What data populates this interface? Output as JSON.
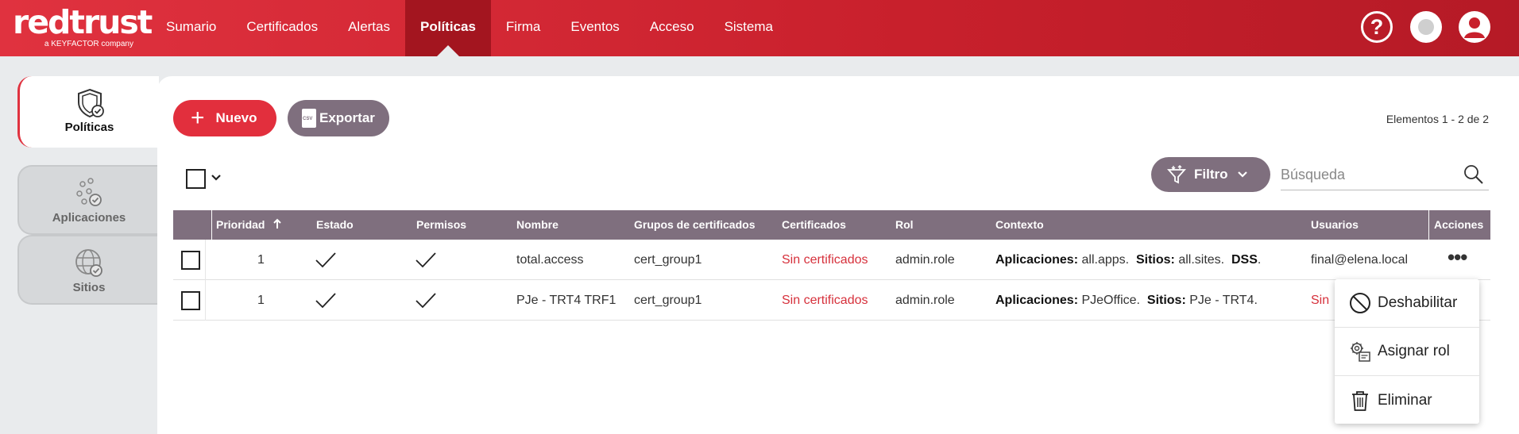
{
  "brand": {
    "name": "redtrust",
    "tagline": "a KEYFACTOR company"
  },
  "nav": {
    "items": [
      "Sumario",
      "Certificados",
      "Alertas",
      "Políticas",
      "Firma",
      "Eventos",
      "Acceso",
      "Sistema"
    ],
    "active": "Políticas",
    "help_icon": "?"
  },
  "sidebar": {
    "items": [
      {
        "label": "Políticas",
        "icon": "shield-check-icon",
        "active": true
      },
      {
        "label": "Aplicaciones",
        "icon": "apps-check-icon",
        "active": false
      },
      {
        "label": "Sitios",
        "icon": "globe-check-icon",
        "active": false
      }
    ]
  },
  "toolbar": {
    "new_label": "Nuevo",
    "export_label": "Exportar",
    "export_badge": "CSV",
    "elements_count": "Elementos 1 - 2 de 2",
    "filter_label": "Filtro",
    "search_placeholder": "Búsqueda"
  },
  "table": {
    "columns": [
      "Prioridad",
      "Estado",
      "Permisos",
      "Nombre",
      "Grupos de certificados",
      "Certificados",
      "Rol",
      "Contexto",
      "Usuarios",
      "Acciones"
    ],
    "sort_column": "Prioridad",
    "sort_direction": "asc",
    "rows": [
      {
        "priority": "1",
        "state": "check",
        "permissions": "check",
        "name": "total.access",
        "groups": "cert_group1",
        "certificates": "Sin certificados",
        "role": "admin.role",
        "context": {
          "apps_label": "Aplicaciones:",
          "apps_value": "all.apps.",
          "sites_label": "Sitios:",
          "sites_value": "all.sites.",
          "extra": "DSS",
          "extra_suffix": "."
        },
        "users": "final@elena.local",
        "actions": "•••"
      },
      {
        "priority": "1",
        "state": "check",
        "permissions": "check",
        "name": "PJe - TRT4 TRF1",
        "groups": "cert_group1",
        "certificates": "Sin certificados",
        "role": "admin.role",
        "context": {
          "apps_label": "Aplicaciones:",
          "apps_value": "PJeOffice.",
          "sites_label": "Sitios:",
          "sites_value": "PJe - TRT4."
        },
        "users": "Sin"
      }
    ]
  },
  "actions_menu": {
    "items": [
      {
        "label": "Deshabilitar",
        "icon": "disable-icon"
      },
      {
        "label": "Asignar rol",
        "icon": "assign-role-icon"
      },
      {
        "label": "Eliminar",
        "icon": "trash-icon"
      }
    ]
  },
  "colors": {
    "brand_red": "#e0323f",
    "nav_active": "#a3151f",
    "header_mauve": "#7f6f7e",
    "link_red": "#d6303b"
  }
}
